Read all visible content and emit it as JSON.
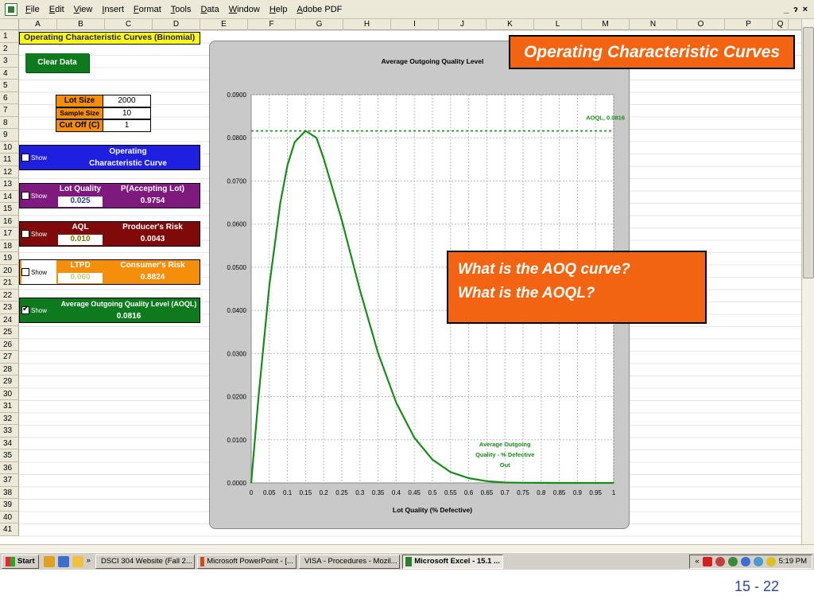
{
  "menu": [
    "File",
    "Edit",
    "View",
    "Insert",
    "Format",
    "Tools",
    "Data",
    "Window",
    "Help",
    "Adobe PDF"
  ],
  "window_controls": [
    "_",
    "ɂ",
    "×"
  ],
  "columns": [
    "A",
    "B",
    "C",
    "D",
    "E",
    "F",
    "G",
    "H",
    "I",
    "J",
    "K",
    "L",
    "M",
    "N",
    "O",
    "P",
    "Q"
  ],
  "rows": [
    "1",
    "2",
    "3",
    "4",
    "5",
    "6",
    "7",
    "8",
    "9",
    "10",
    "11",
    "12",
    "13",
    "14",
    "15",
    "16",
    "17",
    "18",
    "19",
    "20",
    "21",
    "22",
    "23",
    "24",
    "25",
    "26",
    "27",
    "28",
    "29",
    "30",
    "31",
    "32",
    "33",
    "34",
    "35",
    "36",
    "37",
    "38",
    "39",
    "40",
    "41"
  ],
  "sheet_title": "Operating Characteristic Curves (Binomial)",
  "clear_button": "Clear Data",
  "params": {
    "lot_size_label": "Lot Size",
    "lot_size": "2000",
    "sample_size_label": "Sample Size",
    "sample_size": "10",
    "cutoff_label": "Cut Off (C)",
    "cutoff": "1"
  },
  "panels": {
    "show_label": "Show",
    "oc": {
      "title_line1": "Operating",
      "title_line2": "Characteristic Curve",
      "checked": false,
      "color": "#1f1fe0"
    },
    "lot": {
      "label": "Lot Quality",
      "value": "0.025",
      "result_label": "P(Accepting Lot)",
      "result": "0.9754",
      "color": "#7e1a7e"
    },
    "aql": {
      "label": "AQL",
      "value": "0.010",
      "result_label": "Producer's Risk",
      "result": "0.0043",
      "color": "#7e0a0a"
    },
    "ltpd": {
      "label": "LTPD",
      "value": "0.060",
      "result_label": "Consumer's Risk",
      "result": "0.8824",
      "color": "#f58e0b"
    },
    "aoql": {
      "label": "Average Outgoing Quality Level (AOQL)",
      "value": "0.0816",
      "checked": true,
      "color": "#0d7a1e"
    }
  },
  "callouts": {
    "top": "Operating Characteristic Curves",
    "line1": "What is the AOQ curve?",
    "line2": "What is the AOQL?"
  },
  "chart_data": {
    "type": "line",
    "title": "Average Outgoing Quality Level",
    "xlabel": "Lot Quality (% Defective)",
    "ylabel": "",
    "xlim": [
      0,
      1
    ],
    "ylim": [
      0,
      0.09
    ],
    "x_ticks": [
      "0",
      "0.05",
      "0.1",
      "0.15",
      "0.2",
      "0.25",
      "0.3",
      "0.35",
      "0.4",
      "0.45",
      "0.5",
      "0.55",
      "0.6",
      "0.65",
      "0.7",
      "0.75",
      "0.8",
      "0.85",
      "0.9",
      "0.95",
      "1"
    ],
    "y_ticks": [
      "0.0000",
      "0.0100",
      "0.0200",
      "0.0300",
      "0.0400",
      "0.0500",
      "0.0600",
      "0.0700",
      "0.0800",
      "0.0900"
    ],
    "grid": true,
    "series": [
      {
        "name": "Average Outgoing Quality - % Defective Out",
        "color": "#1a8a1a",
        "x": [
          0,
          0.02,
          0.05,
          0.08,
          0.1,
          0.12,
          0.15,
          0.18,
          0.2,
          0.25,
          0.3,
          0.35,
          0.4,
          0.45,
          0.5,
          0.55,
          0.6,
          0.65,
          0.7,
          0.75,
          0.8,
          0.85,
          0.9,
          0.95,
          1
        ],
        "y": [
          0,
          0.0197,
          0.0457,
          0.0648,
          0.0736,
          0.079,
          0.0816,
          0.08,
          0.0752,
          0.0609,
          0.0447,
          0.0301,
          0.0186,
          0.0105,
          0.0054,
          0.0025,
          0.0011,
          0.0004,
          0.0001,
          4e-05,
          1e-05,
          0,
          0,
          0,
          0
        ]
      },
      {
        "name": "AOQL, 0.0816",
        "color": "#1a8a1a",
        "dashed": true,
        "y_const": 0.0816
      }
    ],
    "annotations": [
      "AOQL, 0.0816",
      "Average Outgoing",
      "Quality - % Defective",
      "Out"
    ]
  },
  "taskbar": {
    "start": "Start",
    "more": "»",
    "tasks": [
      "DSCI 304 Website (Fall 2...",
      "Microsoft PowerPoint - [...",
      "VISA - Procedures - Mozil...",
      "Microsoft Excel - 15.1 ..."
    ],
    "tray_more": "«",
    "time": "5:19 PM"
  },
  "slide_number": "15 - 22"
}
